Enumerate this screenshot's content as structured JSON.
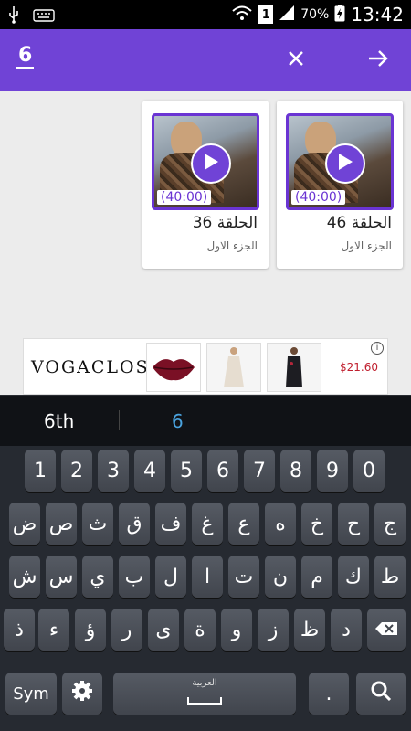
{
  "status_bar": {
    "battery": "70%",
    "time": "13:42",
    "sim_slot": "1"
  },
  "search": {
    "query": "6"
  },
  "results": [
    {
      "title": "الحلقة 46",
      "subtitle": "الجزء الاول",
      "duration": "(40:00)"
    },
    {
      "title": "الحلقة 36",
      "subtitle": "الجزء الاول",
      "duration": "(40:00)"
    }
  ],
  "ad": {
    "brand": "VOGACLOSET",
    "price": "$21.60",
    "info": "i"
  },
  "suggestions": {
    "left": "6th",
    "right": "6"
  },
  "keyboard": {
    "row1": [
      "1",
      "2",
      "3",
      "4",
      "5",
      "6",
      "7",
      "8",
      "9",
      "0"
    ],
    "row2": [
      "ج",
      "ح",
      "خ",
      "ه",
      "ع",
      "غ",
      "ف",
      "ق",
      "ث",
      "ص",
      "ض"
    ],
    "row3": [
      "ط",
      "ك",
      "م",
      "ن",
      "ت",
      "ا",
      "ل",
      "ب",
      "ي",
      "س",
      "ش"
    ],
    "row4": [
      "د",
      "ظ",
      "ز",
      "و",
      "ة",
      "ى",
      "ر",
      "ؤ",
      "ء",
      "ذ"
    ],
    "sym_label": "Sym",
    "space_label": "العربية",
    "period_label": "."
  },
  "colors": {
    "primary": "#7043d6",
    "price": "#c0202f",
    "suggestion_active": "#4aa3df"
  }
}
